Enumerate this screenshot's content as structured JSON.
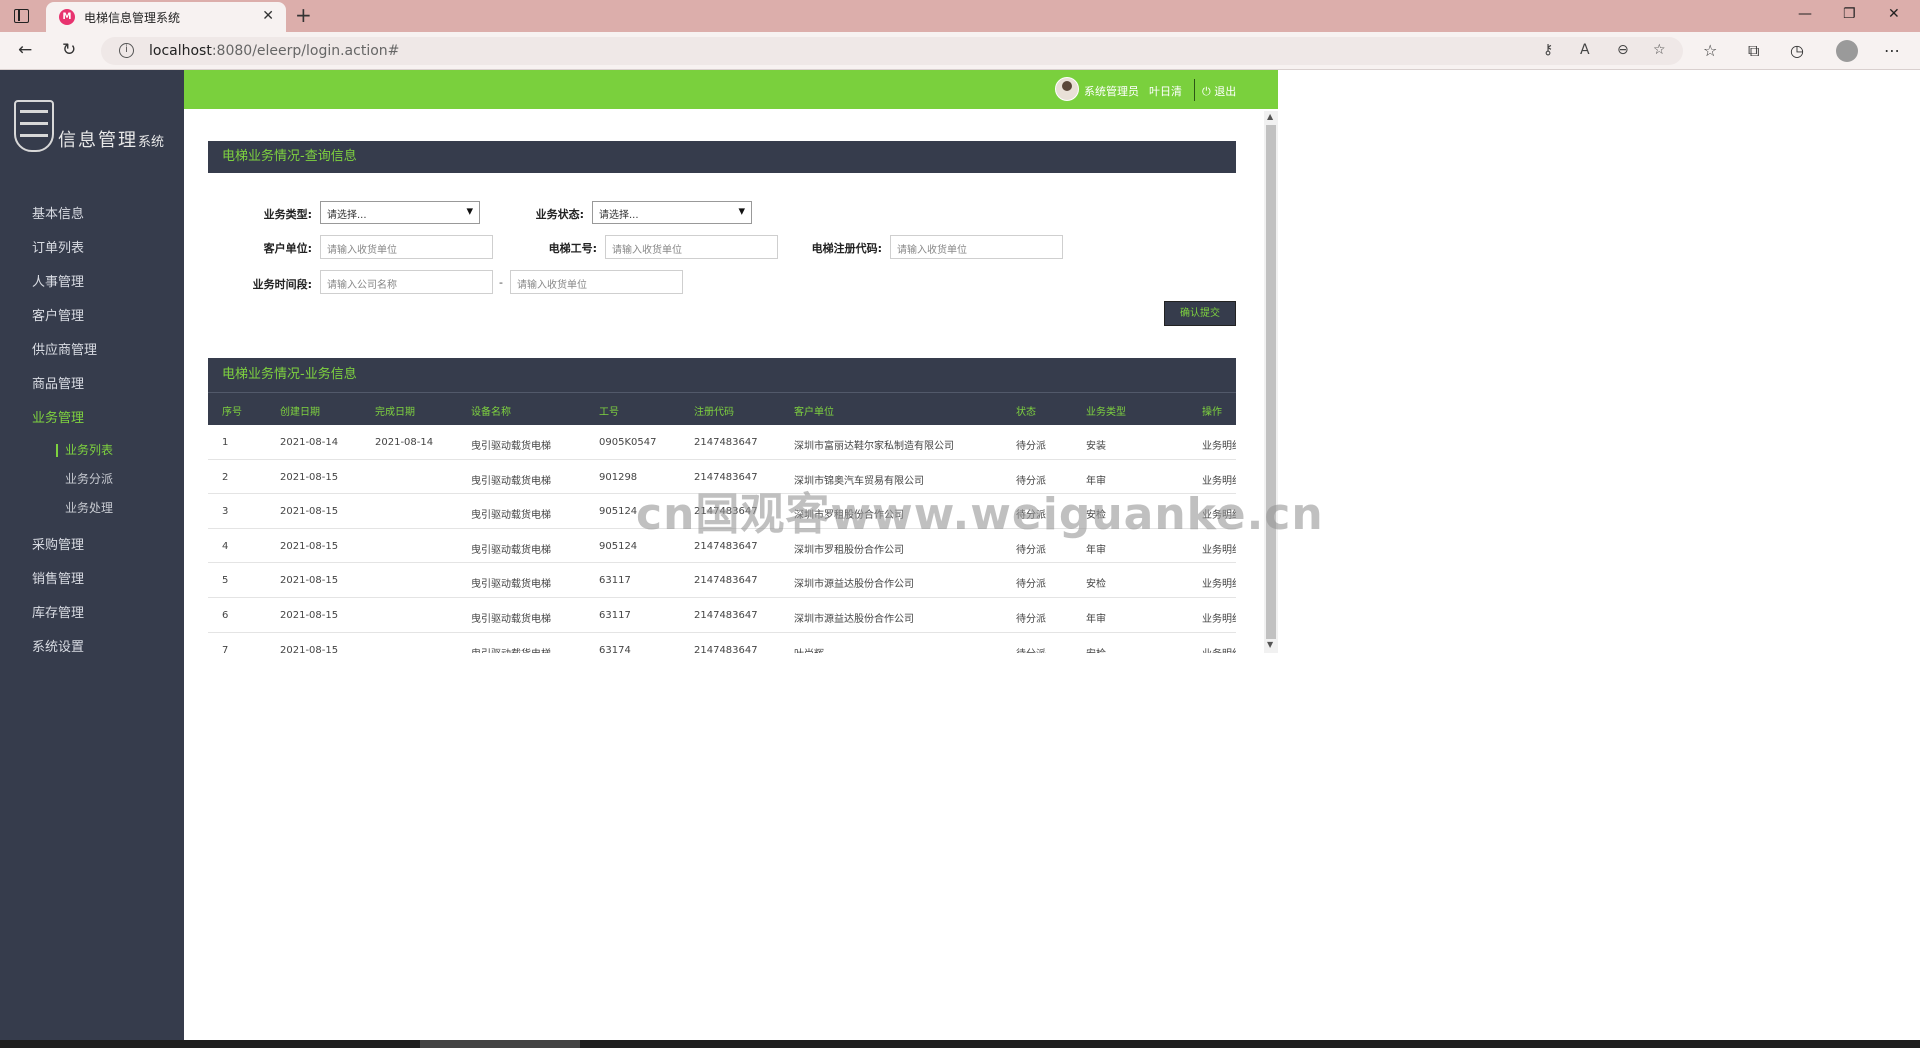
{
  "browser": {
    "tab_title": "电梯信息管理系统",
    "favicon_text": "M",
    "url_host": "localhost",
    "url_rest": ":8080/eleerp/login.action#"
  },
  "logo": {
    "title": "信息管理",
    "suffix": "系统"
  },
  "sidebar": {
    "items": [
      "基本信息",
      "订单列表",
      "人事管理",
      "客户管理",
      "供应商管理",
      "商品管理",
      "业务管理"
    ],
    "sub_items": [
      "业务列表",
      "业务分派",
      "业务处理"
    ],
    "items_after": [
      "采购管理",
      "销售管理",
      "库存管理",
      "系统设置"
    ]
  },
  "topbar": {
    "role": "系统管理员",
    "user": "叶日清",
    "logout": "退出"
  },
  "query_panel": {
    "title": "电梯业务情况-查询信息",
    "labels": {
      "biz_type": "业务类型:",
      "biz_status": "业务状态:",
      "customer": "客户单位:",
      "job_no": "电梯工号:",
      "reg_code": "电梯注册代码:",
      "period": "业务时间段:"
    },
    "biz_type_value": "请选择...",
    "biz_status_value": "请选择...",
    "placeholders": {
      "customer": "请输入收货单位",
      "job_no": "请输入收货单位",
      "reg_code": "请输入收货单位",
      "period_start": "请输入公司名称",
      "period_end": "请输入收货单位"
    },
    "dash": "-",
    "submit": "确认提交"
  },
  "business_panel": {
    "title": "电梯业务情况-业务信息",
    "columns": [
      "序号",
      "创建日期",
      "完成日期",
      "设备名称",
      "工号",
      "注册代码",
      "客户单位",
      "状态",
      "业务类型",
      "操作"
    ],
    "rows": [
      [
        "1",
        "2021-08-14",
        "2021-08-14",
        "曳引驱动载货电梯",
        "0905K0547",
        "2147483647",
        "深圳市富丽达鞋尔家私制造有限公司",
        "待分派",
        "安装",
        "业务明细"
      ],
      [
        "2",
        "2021-08-15",
        "",
        "曳引驱动载货电梯",
        "901298",
        "2147483647",
        "深圳市锦奥汽车贸易有限公司",
        "待分派",
        "年审",
        "业务明细"
      ],
      [
        "3",
        "2021-08-15",
        "",
        "曳引驱动载货电梯",
        "905124",
        "2147483647",
        "深圳市罗租股份合作公司",
        "待分派",
        "安检",
        "业务明细"
      ],
      [
        "4",
        "2021-08-15",
        "",
        "曳引驱动载货电梯",
        "905124",
        "2147483647",
        "深圳市罗租股份合作公司",
        "待分派",
        "年审",
        "业务明细"
      ],
      [
        "5",
        "2021-08-15",
        "",
        "曳引驱动载货电梯",
        "63117",
        "2147483647",
        "深圳市源益达股份合作公司",
        "待分派",
        "安检",
        "业务明细"
      ],
      [
        "6",
        "2021-08-15",
        "",
        "曳引驱动载货电梯",
        "63117",
        "2147483647",
        "深圳市源益达股份合作公司",
        "待分派",
        "年审",
        "业务明细"
      ],
      [
        "7",
        "2021-08-15",
        "",
        "曳引驱动载货电梯",
        "63174",
        "2147483647",
        "叶尚辉",
        "待分派",
        "安检",
        "业务明细"
      ]
    ]
  },
  "watermark": "cn国观客www.weiguanke.cn",
  "colors": {
    "accent": "#7ed23f",
    "dark": "#363c4c",
    "topbar": "#7ad03d"
  }
}
